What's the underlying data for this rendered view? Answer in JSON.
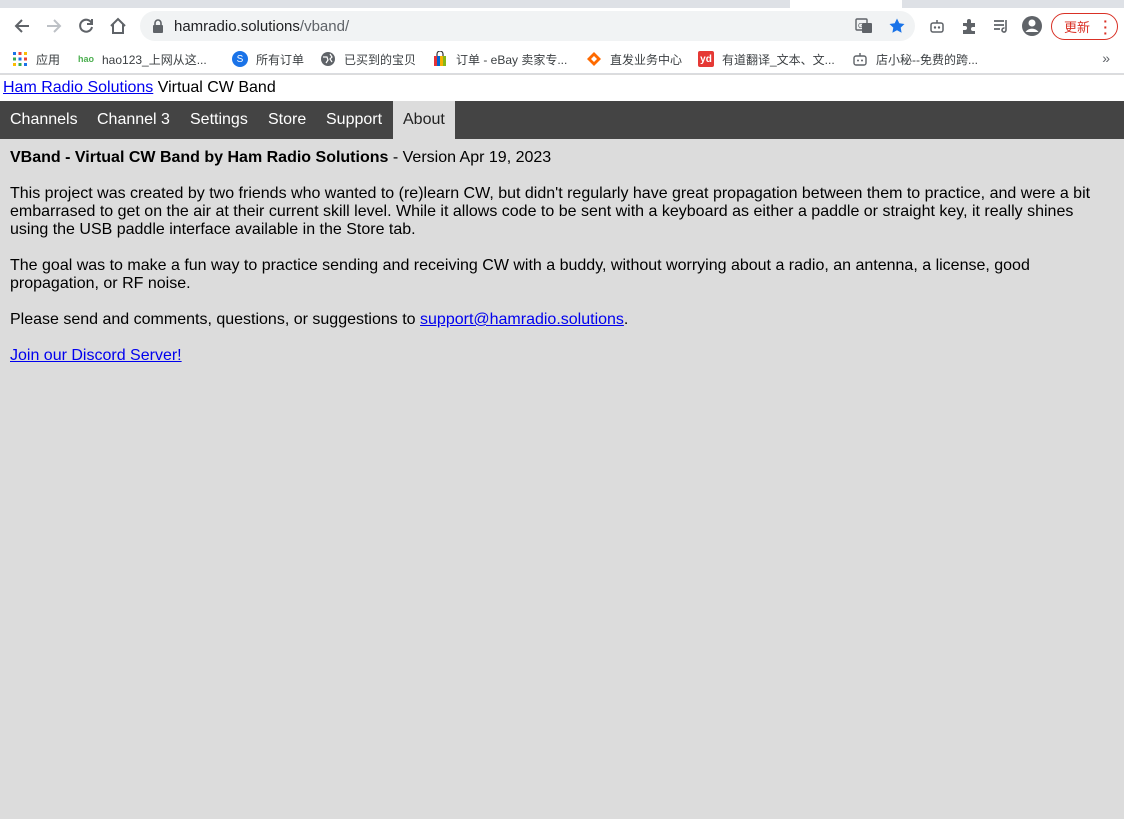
{
  "browser": {
    "url_host": "hamradio.solutions",
    "url_path": "/vband/",
    "update_label": "更新",
    "icons": [
      "back-icon",
      "forward-icon",
      "reload-icon",
      "home-icon",
      "lock-icon",
      "translate-icon",
      "star-icon",
      "bot-icon",
      "extensions-icon",
      "reading-list-icon",
      "profile-icon",
      "menu-icon"
    ]
  },
  "bookmarks": [
    {
      "label": "应用",
      "icon": "apps-icon"
    },
    {
      "label": "hao123_上网从这...",
      "icon": "hao123-icon"
    },
    {
      "label": "所有订单",
      "icon": "orders-icon"
    },
    {
      "label": "已买到的宝贝",
      "icon": "globe-icon"
    },
    {
      "label": "订单 - eBay 卖家专...",
      "icon": "ebay-icon"
    },
    {
      "label": "直发业务中心",
      "icon": "direct-icon"
    },
    {
      "label": "有道翻译_文本、文...",
      "icon": "youdao-icon"
    },
    {
      "label": "店小秘--免费的跨...",
      "icon": "bot-icon"
    }
  ],
  "header": {
    "site_link": "Ham Radio Solutions",
    "title": " Virtual CW Band"
  },
  "nav": {
    "items": [
      "Channels",
      "Channel 3",
      "Settings",
      "Store",
      "Support",
      "About"
    ],
    "active": "About"
  },
  "about": {
    "heading_bold": "VBand - Virtual CW Band by Ham Radio Solutions",
    "heading_version": " - Version Apr 19, 2023",
    "para1": "This project was created by two friends who wanted to (re)learn CW, but didn't regularly have great propagation between them to practice, and were a bit embarrased to get on the air at their current skill level. While it allows code to be sent with a keyboard as either a paddle or straight key, it really shines using the USB paddle interface available in the Store tab.",
    "para2": "The goal was to make a fun way to practice sending and receiving CW with a buddy, without worrying about a radio, an antenna, a license, good propagation, or RF noise.",
    "para3_prefix": "Please send and comments, questions, or suggestions to ",
    "support_email": "support@hamradio.solutions",
    "para3_suffix": ".",
    "discord_link": "Join our Discord Server!"
  },
  "colors": {
    "navbar_bg": "#444444",
    "page_bg": "#dcdcdc",
    "link": "#0000ee",
    "star": "#1a73e8",
    "update": "#d93025"
  }
}
